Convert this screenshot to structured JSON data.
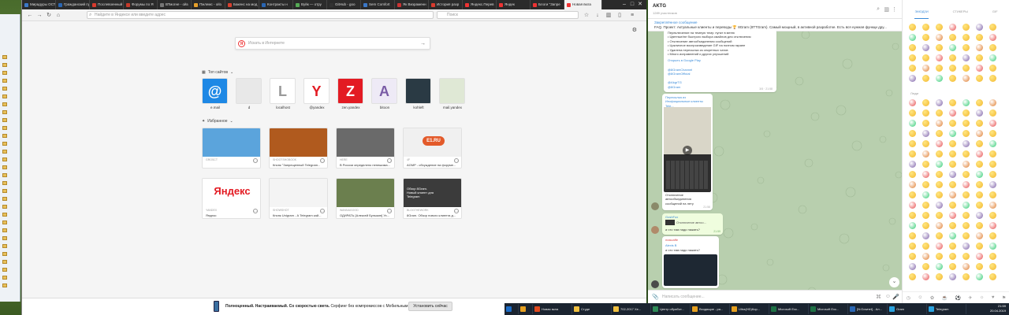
{
  "browser": {
    "tabs": [
      {
        "label": "Мирадуры ОСТ н",
        "color": "#3b78c8"
      },
      {
        "label": "Гражданский пу",
        "color": "#2a66b3"
      },
      {
        "label": "Послевоенный гр",
        "color": "#d83b2e"
      },
      {
        "label": "Форумы по Я",
        "color": "#c63a2a"
      },
      {
        "label": "ВТмогне - ойз",
        "color": "#777"
      },
      {
        "label": "Пжлемс - ойз",
        "color": "#e6a02a"
      },
      {
        "label": "Бакенс на мод",
        "color": "#d8402f"
      },
      {
        "label": "Контракты н",
        "color": "#2a66b3"
      },
      {
        "label": "Вуйк — отру",
        "color": "#5a5"
      },
      {
        "label": "GitHub - goo",
        "color": "#333"
      },
      {
        "label": "Sem Comfort",
        "color": "#3b78c8"
      },
      {
        "label": "Як Визраменн",
        "color": "#c33"
      },
      {
        "label": "История разр",
        "color": "#d83b2e"
      },
      {
        "label": "Яндекс.Перев",
        "color": "#e33"
      },
      {
        "label": "Яндек",
        "color": "#e33"
      },
      {
        "label": "Блоги \"Запре",
        "color": "#e33"
      },
      {
        "label": "Новая вкла",
        "color": "#e33",
        "active": true
      }
    ],
    "address_placeholder": "Найдите в Яндексе или введите адрес",
    "search_placeholder": "Поиск",
    "yandex_search_placeholder": "Искать в Интернете",
    "topsites_label": "Топ сайтов",
    "favorites_label": "Избранное",
    "top_sites": [
      {
        "label": "e.mail",
        "bg": "#1e88e5",
        "glyph": "@",
        "fg": "#fff"
      },
      {
        "label": "d",
        "bg": "#e8e8e8",
        "glyph": "",
        "fg": "#555"
      },
      {
        "label": "localhost",
        "bg": "#ffffff",
        "glyph": "L",
        "fg": "#999"
      },
      {
        "label": "@yandex",
        "bg": "#ffffff",
        "glyph": "Y",
        "fg": "#e31b23"
      },
      {
        "label": "zen.yandex",
        "bg": "#e31b23",
        "glyph": "Z",
        "fg": "#fff"
      },
      {
        "label": "bitoon",
        "bg": "#eeeaf6",
        "glyph": "A",
        "fg": "#7a5ca6"
      },
      {
        "label": "kohleft",
        "bg": "#2a3a44",
        "glyph": "",
        "fg": "#fff"
      },
      {
        "label": "mail.yandex",
        "bg": "#dfe8d5",
        "glyph": "",
        "fg": "#555"
      }
    ],
    "favorites": [
      {
        "source": "GROSCT",
        "title": "",
        "bg": "#5ba4dc"
      },
      {
        "source": "SHOOTSHOBOOK",
        "title": "Кнопк \"Запрещенный Telegram...",
        "bg": "#b05a1e"
      },
      {
        "source": "HERE",
        "title": "В России определено непешима...",
        "bg": "#6a6a6a"
      },
      {
        "source": "4F",
        "title": "AGMP - обсуждение на форуме...",
        "bg": "#f0f0f0"
      },
      {
        "source": "YANDEX",
        "title": "Яндекс",
        "bg": "#ffffff"
      },
      {
        "source": "SHOWSHOT",
        "title": "Кнопк Unigram - А Telegram кай...",
        "bg": "#f4f4f4"
      },
      {
        "source": "WANNAGOOD",
        "title": "ОДИРАТЬ [Алексей Булыкин] Ух...",
        "bg": "#6b7f4e"
      },
      {
        "source": "BLOGTHEWORK",
        "title": "8Gram. Обзор нового клиента д...",
        "bg": "#3b3b3b"
      }
    ],
    "favorite_overlays": {
      "e1": "E1.RU",
      "yandex": "Яндекс",
      "bgram": "Обзор 8Gram. Новый клиент для Telegram"
    },
    "notification": {
      "bold": "Полноценный. Настраиваемый. Со скоростью света.",
      "text": "Серфинг без компромиссов с Мобильным Firefox.",
      "button": "Установить сейчас"
    }
  },
  "telegram": {
    "chat_name": "AKTG",
    "subtitle": "1289 участников",
    "pinned_title": "Закреплённое сообщение",
    "pinned_text": "FAQ. Проект: Актуальные клиенты и переводы 🏆 8Gram (8TTGram). Самый мощный, в активной разработке. Есть вся нужная функци дру...",
    "msg1_lines": "Переключение на темную тему: пункт в меню\n• Цветные/не быстрого выбора смайлов для отключения\n• Отключение автообъединения сообщений\n• Цикличное воспроизведение GIF на полном экране\n• Удалена пересылка из секретных чатов\n• Много исправлений и других улучшений",
    "msg1_link": "Открыть в Google Play",
    "msg1_links2": "@8GramChannel\n@8GramOfficial\n\n@AkgrTG\n@8Gram",
    "msg1_time": "3/5 · 21:58",
    "msg2_head": "Пересылка из Инофициальные клиенты Tele...",
    "msg2_caption": "Отключение\nавтообъединения\nсообщений на лету",
    "msg2_time": "21:58",
    "msg3_name": "GoshFox",
    "msg3_reply": "Отключение автоо...",
    "msg3_text": "а что там надо нажать?",
    "msg3_time": "21:59",
    "msg4_name": "mascaffe",
    "msg4_reply_name": "Alexis B",
    "msg4_reply": "а что там надо нажать?",
    "input_placeholder": "Написать сообщение...",
    "emoji_tabs": [
      "ЭМОДЗИ",
      "СТИКЕРЫ",
      "GIF"
    ],
    "emoji_category": "Люди"
  },
  "taskbar": {
    "items": [
      {
        "label": "",
        "color": "#1c6cc6"
      },
      {
        "label": "",
        "color": "#e6a020"
      },
      {
        "label": "Новая вкла",
        "color": "#e04a1f"
      },
      {
        "label": "Студе",
        "color": "#f0c040"
      },
      {
        "label": "702-2017 Хе...",
        "color": "#f0c040"
      },
      {
        "label": "Центр обработ...",
        "color": "#2e8b57"
      },
      {
        "label": "Входящие - ра...",
        "color": "#e6a020"
      },
      {
        "label": "Ultra(HD)Кор...",
        "color": "#e6a020"
      },
      {
        "label": "Microsoft Exc...",
        "color": "#1e7145"
      },
      {
        "label": "Microsoft Exc...",
        "color": "#1e7145"
      },
      {
        "label": "[N:Gownet] - Ал...",
        "color": "#2a66b3"
      },
      {
        "label": "Gram",
        "color": "#2aa3e0"
      },
      {
        "label": "Telegram",
        "color": "#2aa3e0"
      }
    ],
    "time": "21:59",
    "date": "20.04.2019"
  }
}
